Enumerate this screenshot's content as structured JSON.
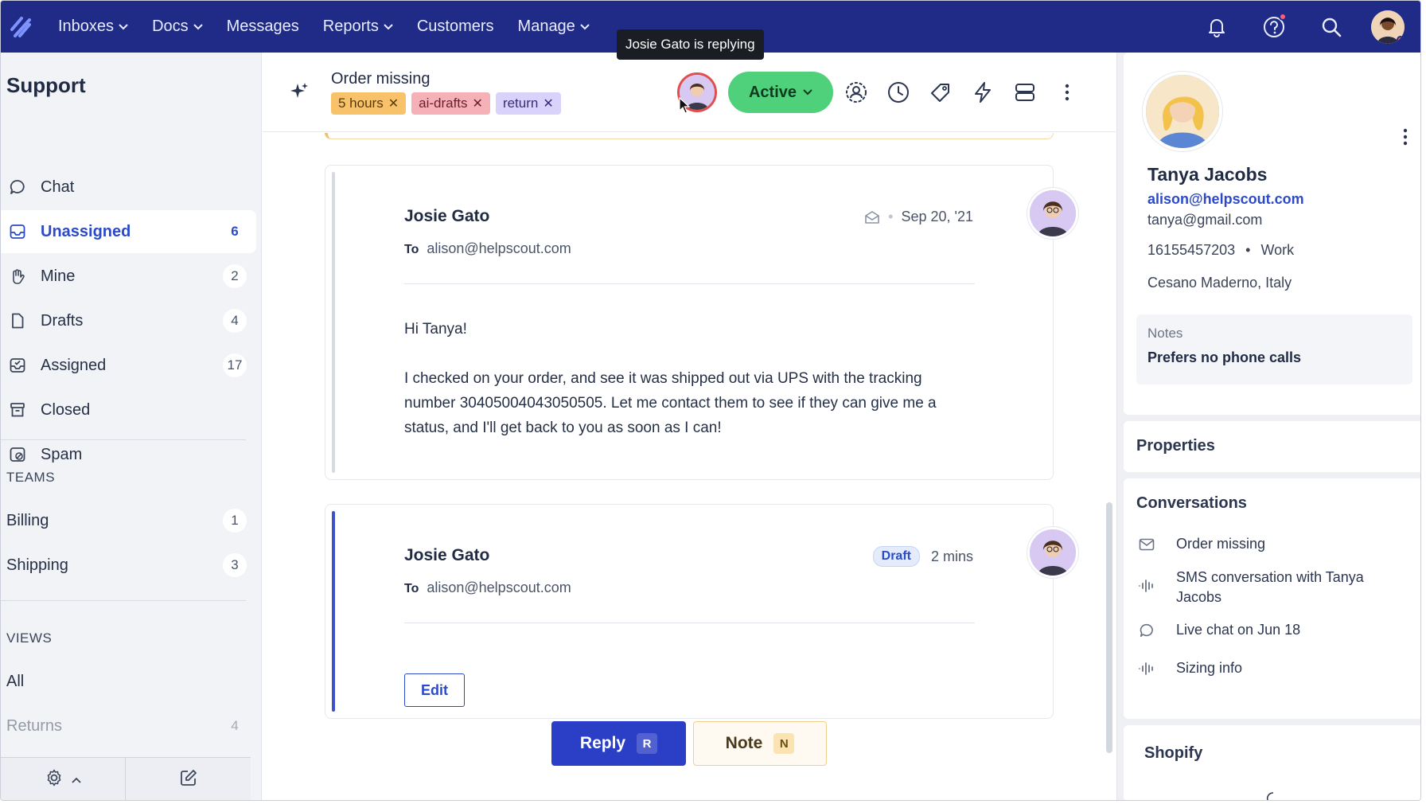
{
  "colors": {
    "nav_bg": "#1f2b86",
    "accent": "#2b49c8",
    "active_green": "#4fd07a",
    "reply_blue": "#2b3fc6",
    "tag_orange": "#f7c26a",
    "tag_pink": "#f6b0b8",
    "tag_purple": "#d9d2fb"
  },
  "nav": {
    "items": [
      {
        "label": "Inboxes",
        "has_dropdown": true
      },
      {
        "label": "Docs",
        "has_dropdown": true
      },
      {
        "label": "Messages",
        "has_dropdown": false
      },
      {
        "label": "Reports",
        "has_dropdown": true
      },
      {
        "label": "Customers",
        "has_dropdown": false
      },
      {
        "label": "Manage",
        "has_dropdown": true
      }
    ],
    "icons": [
      "bell-icon",
      "help-icon",
      "search-icon",
      "user-avatar"
    ]
  },
  "sidebar": {
    "title": "Support",
    "folders": [
      {
        "label": "Chat",
        "count": "",
        "icon": "chat-bubble-icon"
      },
      {
        "label": "Unassigned",
        "count": "6",
        "icon": "inbox-icon",
        "active": true
      },
      {
        "label": "Mine",
        "count": "2",
        "icon": "hand-icon"
      },
      {
        "label": "Drafts",
        "count": "4",
        "icon": "document-icon"
      },
      {
        "label": "Assigned",
        "count": "17",
        "icon": "inbox-check-icon"
      },
      {
        "label": "Closed",
        "count": "",
        "icon": "archive-icon"
      },
      {
        "label": "Spam",
        "count": "",
        "icon": "spam-icon"
      }
    ],
    "teams_heading": "TEAMS",
    "teams": [
      {
        "label": "Billing",
        "count": "1"
      },
      {
        "label": "Shipping",
        "count": "3"
      }
    ],
    "views_heading": "VIEWS",
    "views": [
      {
        "label": "All",
        "count": ""
      },
      {
        "label": "Returns",
        "count": "4"
      }
    ]
  },
  "conversation": {
    "subject": "Order missing",
    "tags": [
      {
        "label": "5 hours",
        "color": "orange"
      },
      {
        "label": "ai-drafts",
        "color": "pink"
      },
      {
        "label": "return",
        "color": "purple"
      }
    ],
    "tooltip": "Josie Gato is replying",
    "status": "Active",
    "header_icons": [
      "assign-icon",
      "clock-icon",
      "tag-icon",
      "lightning-icon",
      "layout-icon",
      "more-vertical-icon"
    ]
  },
  "thread": {
    "messages": [
      {
        "author": "Josie Gato",
        "to_label": "To",
        "to": "alison@helpscout.com",
        "date": "Sep 20, '21",
        "greeting": "Hi Tanya!",
        "body": "I checked on your order, and see it was shipped out via UPS with the tracking number 30405004043050505. Let me contact them to see if they can give me a status, and I'll get back to you as soon as I can!"
      },
      {
        "author": "Josie Gato",
        "to_label": "To",
        "to": "alison@helpscout.com",
        "badge": "Draft",
        "time": "2 mins",
        "edit_label": "Edit"
      }
    ],
    "reply_label": "Reply",
    "reply_key": "R",
    "note_label": "Note",
    "note_key": "N"
  },
  "customer": {
    "name": "Tanya Jacobs",
    "email_primary": "alison@helpscout.com",
    "email_secondary": "tanya@gmail.com",
    "phone": "16155457203",
    "phone_type": "Work",
    "location": "Cesano Maderno, Italy",
    "notes_label": "Notes",
    "notes_text": "Prefers no phone calls",
    "properties_title": "Properties",
    "conversations_title": "Conversations",
    "conversations": [
      {
        "label": "Order missing",
        "icon": "envelope-icon"
      },
      {
        "label": "SMS conversation with Tanya Jacobs",
        "icon": "sms-wave-icon"
      },
      {
        "label": "Live chat on Jun 18",
        "icon": "chat-bubble-icon"
      },
      {
        "label": "Sizing info",
        "icon": "sms-wave-icon"
      }
    ],
    "shopify_title": "Shopify"
  },
  "sidebar_footer": {
    "icons": [
      "gear-icon",
      "compose-icon"
    ]
  }
}
